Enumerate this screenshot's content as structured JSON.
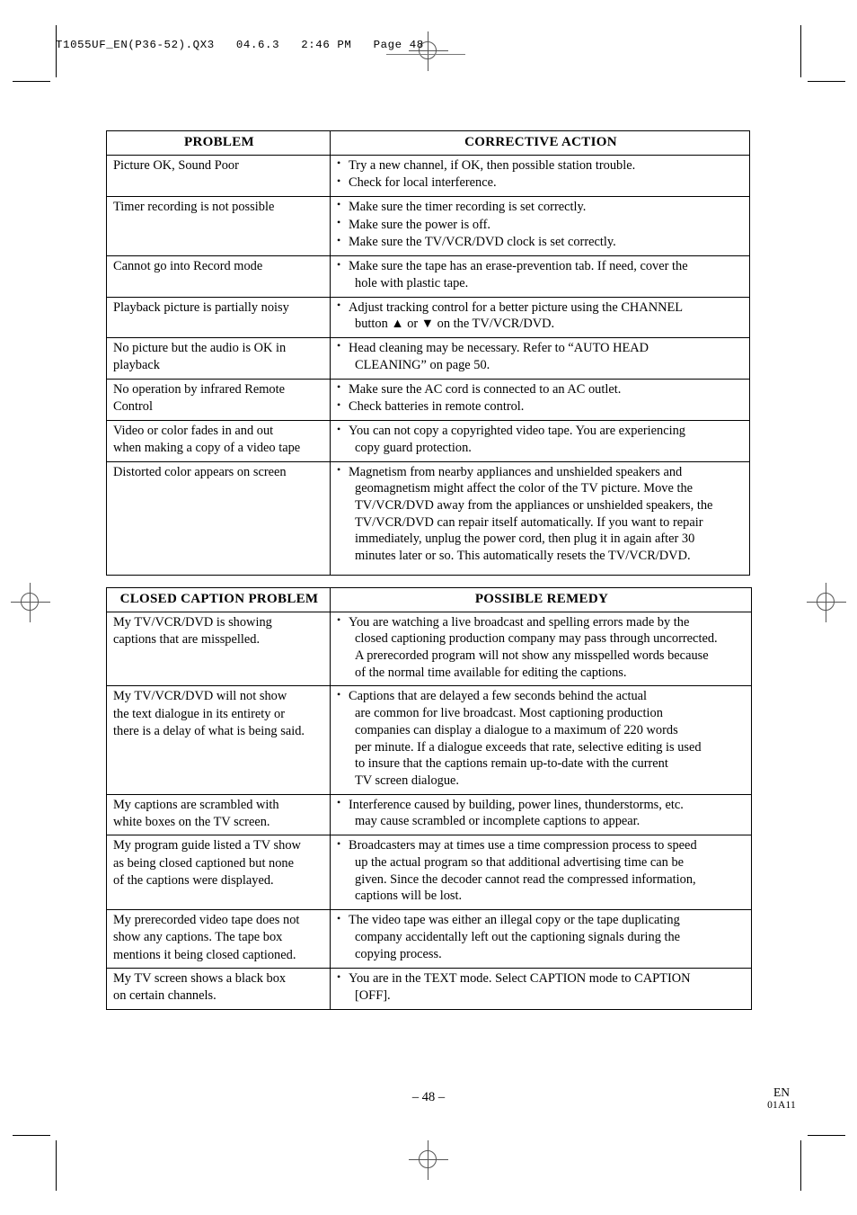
{
  "page": {
    "slug_line": "T1055UF_EN(P36-52).QX3   04.6.3   2:46 PM   Page 48",
    "page_number": "– 48 –",
    "footer_language": "EN",
    "footer_code": "01A11"
  },
  "troubleshooting_table": {
    "headers": {
      "problem": "PROBLEM",
      "action": "CORRECTIVE ACTION"
    },
    "rows": [
      {
        "problem": [
          "Picture OK, Sound Poor"
        ],
        "actions": [
          [
            "Try a new channel, if OK, then possible station trouble."
          ],
          [
            "Check for local interference."
          ]
        ]
      },
      {
        "problem": [
          "Timer recording is not possible"
        ],
        "actions": [
          [
            "Make sure the timer recording is set correctly."
          ],
          [
            "Make sure the power is off."
          ],
          [
            "Make sure the TV/VCR/DVD clock is set correctly."
          ]
        ]
      },
      {
        "problem": [
          "Cannot go into Record mode"
        ],
        "actions": [
          [
            "Make sure the tape has an erase-prevention tab. If need, cover the",
            "hole with plastic tape."
          ]
        ]
      },
      {
        "problem": [
          "Playback picture is partially noisy"
        ],
        "actions": [
          [
            "Adjust tracking control for a better picture using the CHANNEL",
            "button ▲ or ▼ on the TV/VCR/DVD."
          ]
        ]
      },
      {
        "problem": [
          "No picture but the audio is OK in",
          "playback"
        ],
        "actions": [
          [
            "Head cleaning may be necessary. Refer to “AUTO HEAD",
            "CLEANING” on page 50."
          ]
        ]
      },
      {
        "problem": [
          "No operation by infrared Remote",
          "Control"
        ],
        "actions": [
          [
            "Make sure the AC cord is connected to an AC outlet."
          ],
          [
            "Check batteries in remote control."
          ]
        ]
      },
      {
        "problem": [
          "Video or color fades in and out",
          "when making a copy of a video tape"
        ],
        "actions": [
          [
            "You can not copy a copyrighted video tape. You are experiencing",
            "copy guard protection."
          ]
        ]
      },
      {
        "problem": [
          "Distorted color appears on screen"
        ],
        "actions": [
          [
            "Magnetism from nearby appliances and unshielded speakers and",
            "geomagnetism might affect the color of the TV picture. Move the",
            "TV/VCR/DVD away from the appliances or unshielded speakers, the",
            "TV/VCR/DVD can repair itself automatically. If you want to repair",
            "immediately, unplug the power cord, then plug it in again after 30",
            "minutes later or so. This automatically resets the TV/VCR/DVD."
          ]
        ]
      }
    ]
  },
  "closed_caption_table": {
    "headers": {
      "problem": "CLOSED CAPTION PROBLEM",
      "remedy": "POSSIBLE REMEDY"
    },
    "rows": [
      {
        "problem": [
          "My TV/VCR/DVD is showing",
          "captions that are misspelled."
        ],
        "remedies": [
          [
            "You are watching a live broadcast and spelling errors made by the",
            "closed captioning production company may pass through uncorrected.",
            "A prerecorded program will not show any misspelled words because",
            "of the normal time available for editing the captions."
          ]
        ]
      },
      {
        "problem": [
          "My TV/VCR/DVD will not show",
          "the text dialogue in its entirety or",
          "there is a delay of what is being said."
        ],
        "remedies": [
          [
            "Captions that are delayed a few seconds behind the actual",
            " are common for live broadcast. Most captioning production",
            "companies can display a dialogue to a maximum of 220 words",
            "per minute. If a dialogue exceeds that rate, selective editing is used",
            "to insure that the captions remain up-to-date with the current",
            "TV screen dialogue."
          ]
        ]
      },
      {
        "problem": [
          "My captions are scrambled with",
          "white boxes on the TV screen."
        ],
        "remedies": [
          [
            "Interference caused by building, power lines, thunderstorms, etc.",
            "may cause scrambled or incomplete captions to appear."
          ]
        ]
      },
      {
        "problem": [
          "My program guide listed a TV show",
          "as being closed captioned but none",
          "of the captions were displayed."
        ],
        "remedies": [
          [
            "Broadcasters may at times use a time compression process to speed",
            "up the actual program so that additional advertising time can be",
            "given. Since the decoder cannot read the compressed information,",
            "captions will be lost."
          ]
        ]
      },
      {
        "problem": [
          "My prerecorded video tape does not",
          "show any captions. The tape box",
          "mentions it being closed captioned."
        ],
        "remedies": [
          [
            "The video tape was either an illegal copy or the tape duplicating",
            "company accidentally left out the captioning signals during the",
            "copying process."
          ]
        ]
      },
      {
        "problem": [
          "My TV screen shows a black box",
          "on certain channels."
        ],
        "remedies": [
          [
            "You are in the TEXT mode. Select CAPTION mode to CAPTION",
            "[OFF]."
          ]
        ]
      }
    ]
  }
}
